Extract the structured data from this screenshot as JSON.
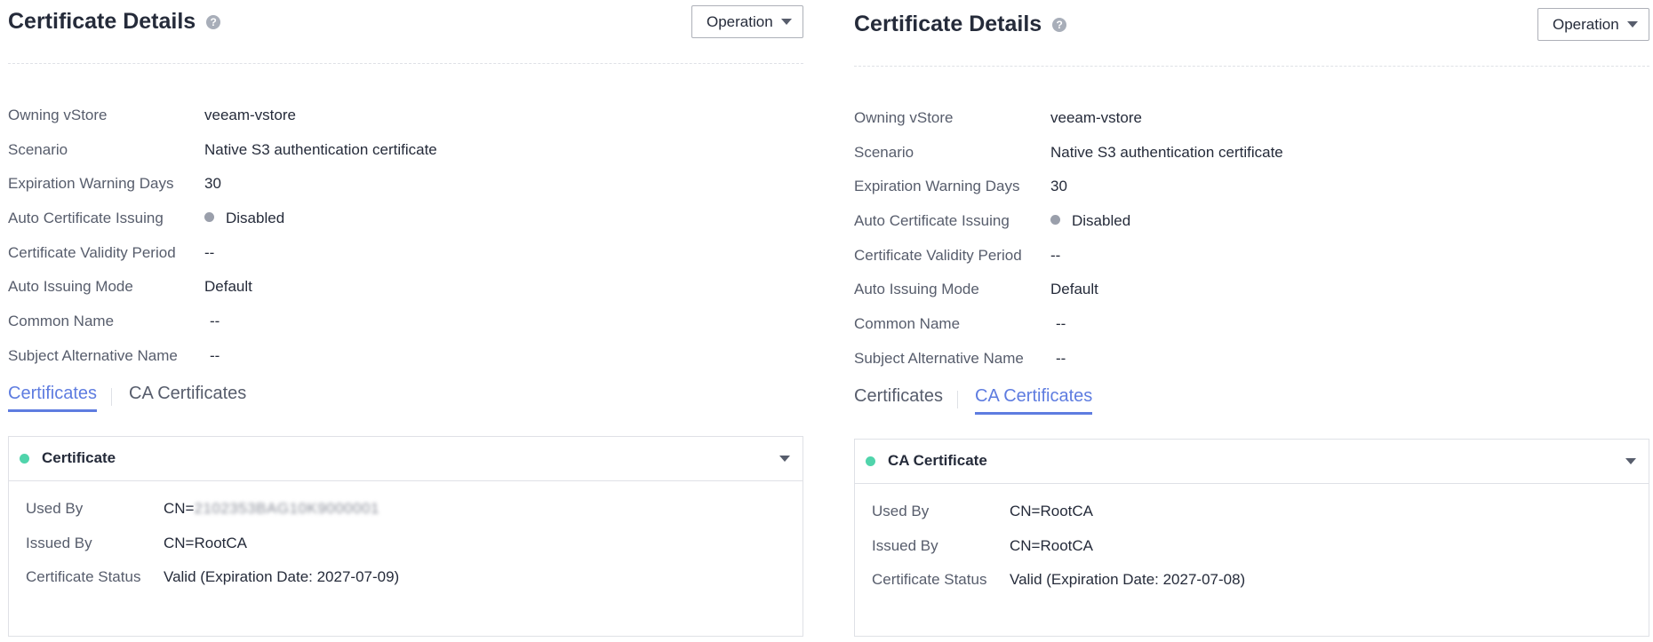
{
  "left": {
    "title": "Certificate Details",
    "help_icon": "?",
    "operation_label": "Operation",
    "props": {
      "owning_vstore": {
        "label": "Owning vStore",
        "value": "veeam-vstore"
      },
      "scenario": {
        "label": "Scenario",
        "value": "Native S3 authentication certificate"
      },
      "expiration_warning_days": {
        "label": "Expiration Warning Days",
        "value": "30"
      },
      "auto_issuing": {
        "label": "Auto Certificate Issuing",
        "value": "Disabled"
      },
      "validity_period": {
        "label": "Certificate Validity Period",
        "value": "--"
      },
      "auto_issuing_mode": {
        "label": "Auto Issuing Mode",
        "value": "Default"
      },
      "common_name": {
        "label": "Common Name",
        "value": "--"
      },
      "subject_alt_name": {
        "label": "Subject Alternative Name",
        "value": "--"
      }
    },
    "tabs": [
      {
        "label": "Certificates",
        "active": true
      },
      {
        "label": "CA Certificates",
        "active": false
      }
    ],
    "card": {
      "title": "Certificate",
      "used_by": {
        "label": "Used By",
        "prefix": "CN=",
        "masked": "2102353BAG10K9000001"
      },
      "issued_by": {
        "label": "Issued By",
        "value": "CN=RootCA"
      },
      "status": {
        "label": "Certificate Status",
        "value": "Valid (Expiration Date: 2027-07-09)"
      }
    }
  },
  "right": {
    "title": "Certificate Details",
    "help_icon": "?",
    "operation_label": "Operation",
    "props": {
      "owning_vstore": {
        "label": "Owning vStore",
        "value": "veeam-vstore"
      },
      "scenario": {
        "label": "Scenario",
        "value": "Native S3 authentication certificate"
      },
      "expiration_warning_days": {
        "label": "Expiration Warning Days",
        "value": "30"
      },
      "auto_issuing": {
        "label": "Auto Certificate Issuing",
        "value": "Disabled"
      },
      "validity_period": {
        "label": "Certificate Validity Period",
        "value": "--"
      },
      "auto_issuing_mode": {
        "label": "Auto Issuing Mode",
        "value": "Default"
      },
      "common_name": {
        "label": "Common Name",
        "value": "--"
      },
      "subject_alt_name": {
        "label": "Subject Alternative Name",
        "value": "--"
      }
    },
    "tabs": [
      {
        "label": "Certificates",
        "active": false
      },
      {
        "label": "CA Certificates",
        "active": true
      }
    ],
    "card": {
      "title": "CA Certificate",
      "used_by": {
        "label": "Used By",
        "value": "CN=RootCA"
      },
      "issued_by": {
        "label": "Issued By",
        "value": "CN=RootCA"
      },
      "status": {
        "label": "Certificate Status",
        "value": "Valid (Expiration Date: 2027-07-08)"
      }
    }
  },
  "colors": {
    "accent": "#5e7ce0",
    "text_primary": "#252b3a",
    "text_secondary": "#575d6c",
    "border": "#dfe1e6",
    "status_disabled": "#9a9fab",
    "status_valid": "#50d4ab"
  },
  "icons": {
    "help": "help-icon",
    "dropdown": "chevron-down-icon",
    "status": "status-dot-icon"
  }
}
